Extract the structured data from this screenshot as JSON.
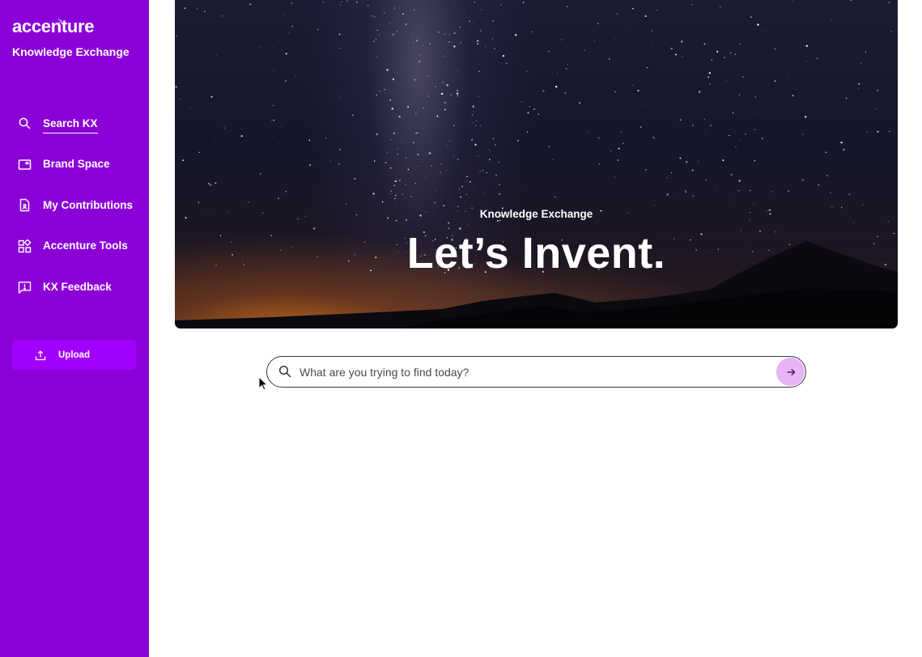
{
  "brand": {
    "logo_text": "accenture",
    "logo_mark": ">",
    "subtitle": "Knowledge Exchange"
  },
  "sidebar": {
    "items": [
      {
        "label": "Search KX",
        "icon": "search-icon",
        "active": true
      },
      {
        "label": "Brand Space",
        "icon": "browser-window-icon",
        "active": false
      },
      {
        "label": "My Contributions",
        "icon": "document-user-icon",
        "active": false
      },
      {
        "label": "Accenture Tools",
        "icon": "apps-grid-icon",
        "active": false
      },
      {
        "label": "KX Feedback",
        "icon": "feedback-icon",
        "active": false
      }
    ],
    "upload": {
      "label": "Upload",
      "icon": "upload-icon"
    }
  },
  "hero": {
    "kicker": "Knowledge Exchange",
    "title": "Let’s Invent."
  },
  "search": {
    "placeholder": "What are you trying to find today?",
    "value": "",
    "submit_icon": "arrow-right-icon"
  },
  "colors": {
    "sidebar_bg": "#8c00d8",
    "upload_bg": "#a100ff",
    "submit_bg": "#e8b3f7",
    "text_on_brand": "#ffffff"
  }
}
